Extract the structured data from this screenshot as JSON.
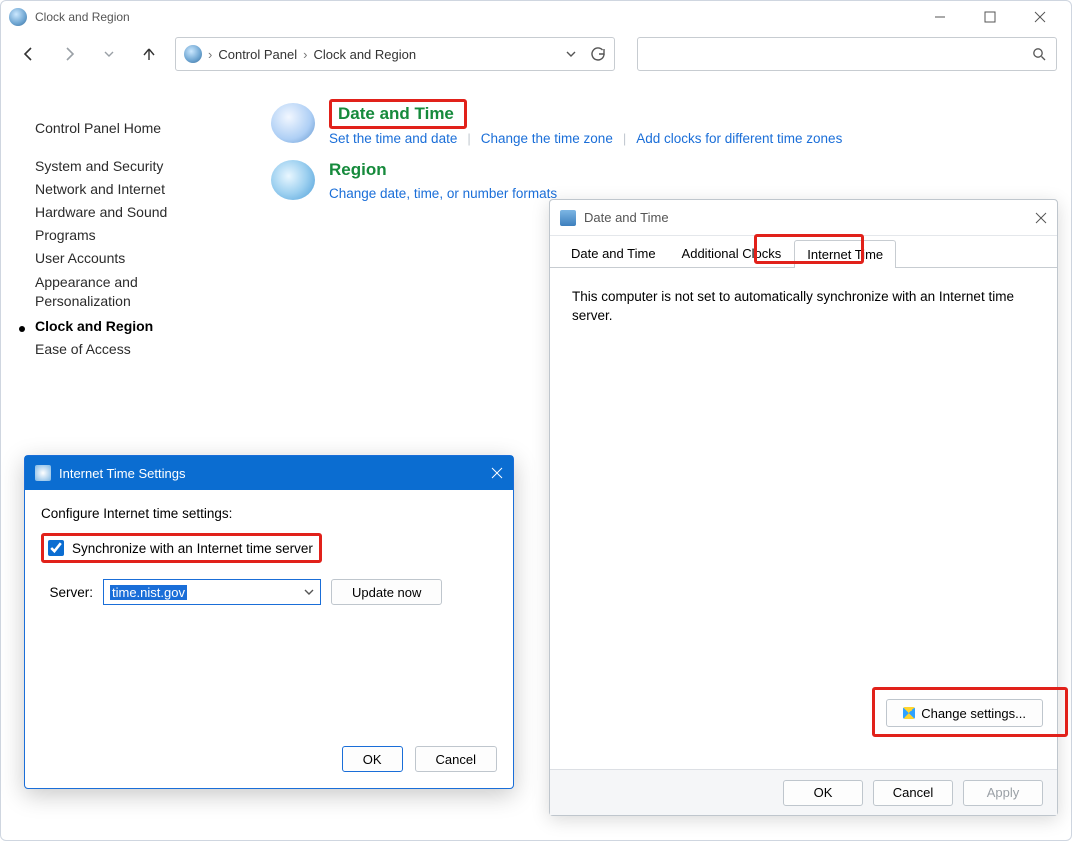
{
  "window": {
    "title": "Clock and Region"
  },
  "breadcrumb": {
    "root": "Control Panel",
    "leaf": "Clock and Region"
  },
  "sidebar": {
    "items": [
      "Control Panel Home",
      "System and Security",
      "Network and Internet",
      "Hardware and Sound",
      "Programs",
      "User Accounts",
      "Appearance and Personalization",
      "Clock and Region",
      "Ease of Access"
    ],
    "active_index": 7
  },
  "categories": {
    "datetime": {
      "title": "Date and Time",
      "links": [
        "Set the time and date",
        "Change the time zone",
        "Add clocks for different time zones"
      ]
    },
    "region": {
      "title": "Region",
      "links": [
        "Change date, time, or number formats"
      ]
    }
  },
  "dtDialog": {
    "title": "Date and Time",
    "tabs": [
      "Date and Time",
      "Additional Clocks",
      "Internet Time"
    ],
    "active_tab": 2,
    "message": "This computer is not set to automatically synchronize with an Internet time server.",
    "changeBtn": "Change settings...",
    "ok": "OK",
    "cancel": "Cancel",
    "apply": "Apply"
  },
  "itsDialog": {
    "title": "Internet Time Settings",
    "subtitle": "Configure Internet time settings:",
    "syncLabel": "Synchronize with an Internet time server",
    "syncChecked": true,
    "serverLabel": "Server:",
    "serverValue": "time.nist.gov",
    "updateNow": "Update now",
    "ok": "OK",
    "cancel": "Cancel"
  }
}
